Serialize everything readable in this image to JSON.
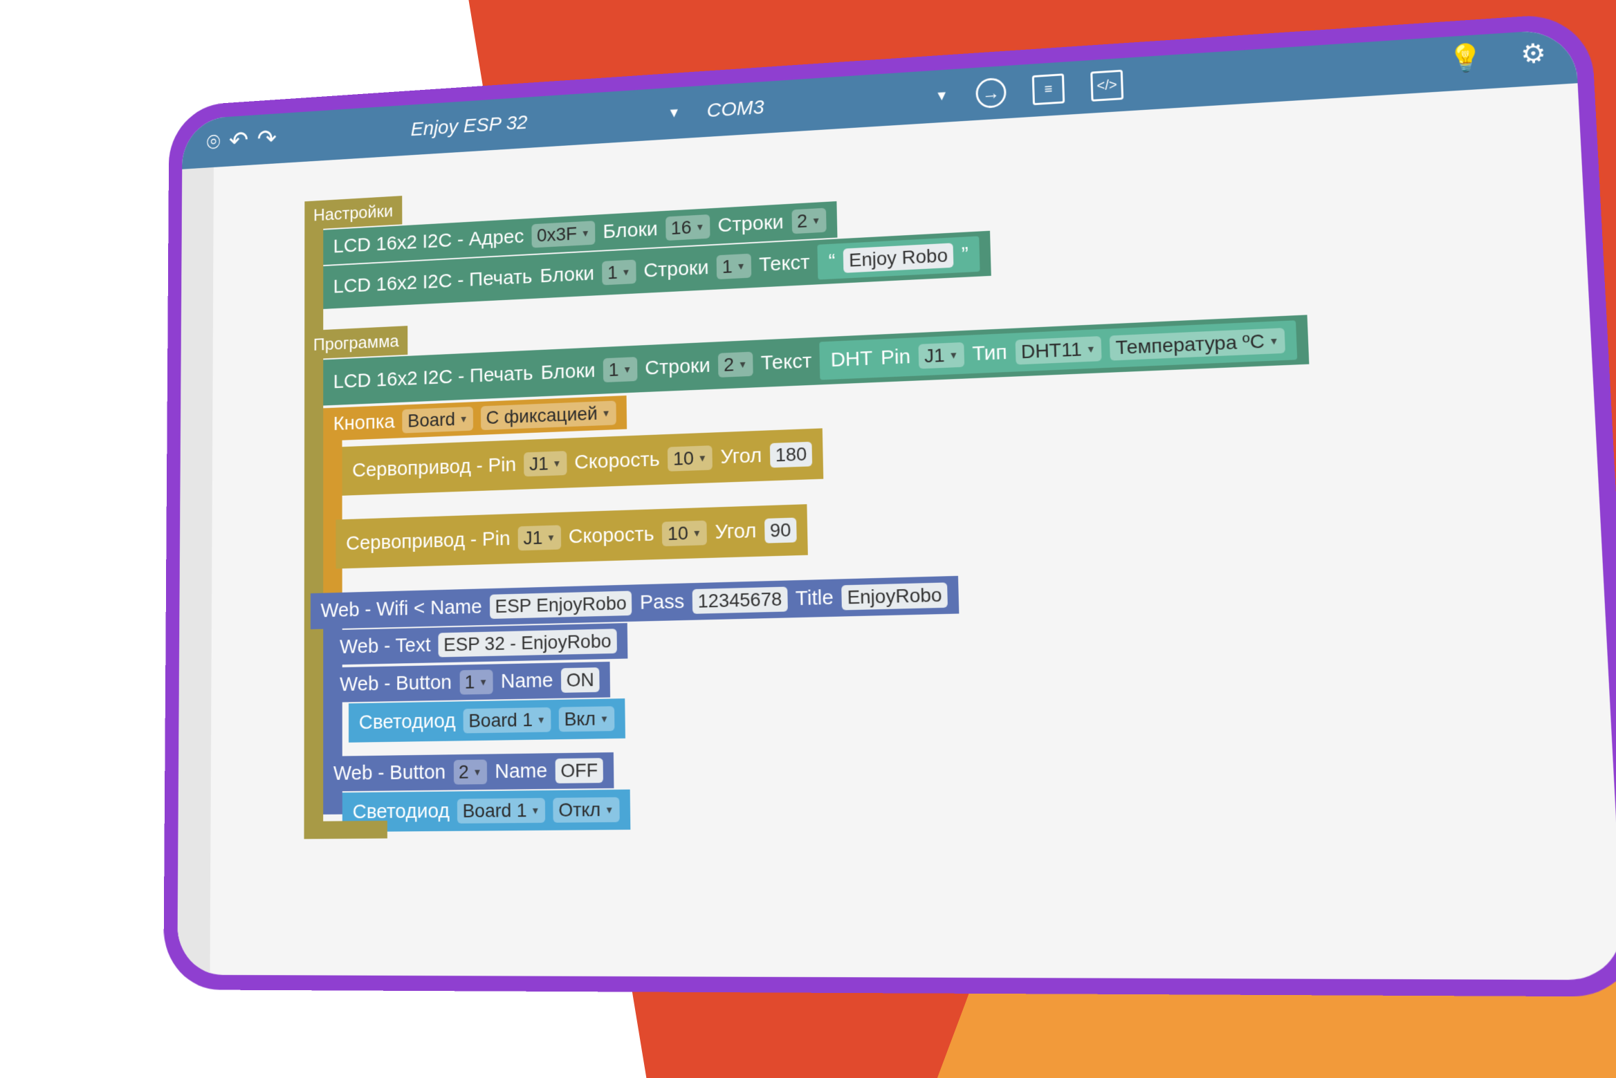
{
  "toolbar": {
    "board": "Enjoy ESP 32",
    "port": "COM3",
    "icons": [
      "camera-icon",
      "undo-icon",
      "redo-icon",
      "upload-icon",
      "comment-icon",
      "code-icon",
      "lightbulb-icon",
      "gear-icon"
    ]
  },
  "blocks": {
    "setup": {
      "hat": "Настройки",
      "lcd_init": {
        "label1": "LCD 16x2 I2C - Адрес",
        "addr": "0x3F",
        "label2": "Блоки",
        "cols": "16",
        "label3": "Строки",
        "rows": "2"
      },
      "lcd_print": {
        "label1": "LCD 16x2 I2C - Печать",
        "label2": "Блоки",
        "block": "1",
        "label3": "Строки",
        "row": "1",
        "label4": "Текст",
        "text": "Enjoy Robo"
      }
    },
    "program": {
      "hat": "Программа",
      "lcd_print": {
        "label1": "LCD 16x2 I2C - Печать",
        "label2": "Блоки",
        "block": "1",
        "label3": "Строки",
        "row": "2",
        "label4": "Текст",
        "dht": "DHT",
        "pin_label": "Pin",
        "pin": "J1",
        "type_label": "Тип",
        "type": "DHT11",
        "measure": "Температура ºC"
      },
      "button": {
        "label": "Кнопка",
        "source": "Board",
        "mode": "С фиксацией"
      },
      "servo1": {
        "label": "Сервопривод - Pin",
        "pin": "J1",
        "speed_label": "Скорость",
        "speed": "10",
        "angle_label": "Угол",
        "angle": "180"
      },
      "servo2": {
        "label": "Сервопривод - Pin",
        "pin": "J1",
        "speed_label": "Скорость",
        "speed": "10",
        "angle_label": "Угол",
        "angle": "90"
      },
      "wifi": {
        "label": "Web - Wifi < Name",
        "name": "ESP EnjoyRobo",
        "pass_label": "Pass",
        "pass": "12345678",
        "title_label": "Title",
        "title": "EnjoyRobo"
      },
      "web_text": {
        "label": "Web - Text",
        "text": "ESP 32 - EnjoyRobo"
      },
      "web_btn1": {
        "label": "Web -  Button",
        "num": "1",
        "name_label": "Name",
        "name": "ON"
      },
      "led1": {
        "label": "Светодиод",
        "board": "Board 1",
        "state": "Вкл"
      },
      "web_btn2": {
        "label": "Web -  Button",
        "num": "2",
        "name_label": "Name",
        "name": "OFF"
      },
      "led2": {
        "label": "Светодиод",
        "board": "Board 1",
        "state": "Откл"
      }
    }
  },
  "colors": {
    "red": "#e14a2d",
    "orange": "#f29a3a",
    "frame": "#8f3fd0",
    "topbar": "#4a7fa8"
  }
}
